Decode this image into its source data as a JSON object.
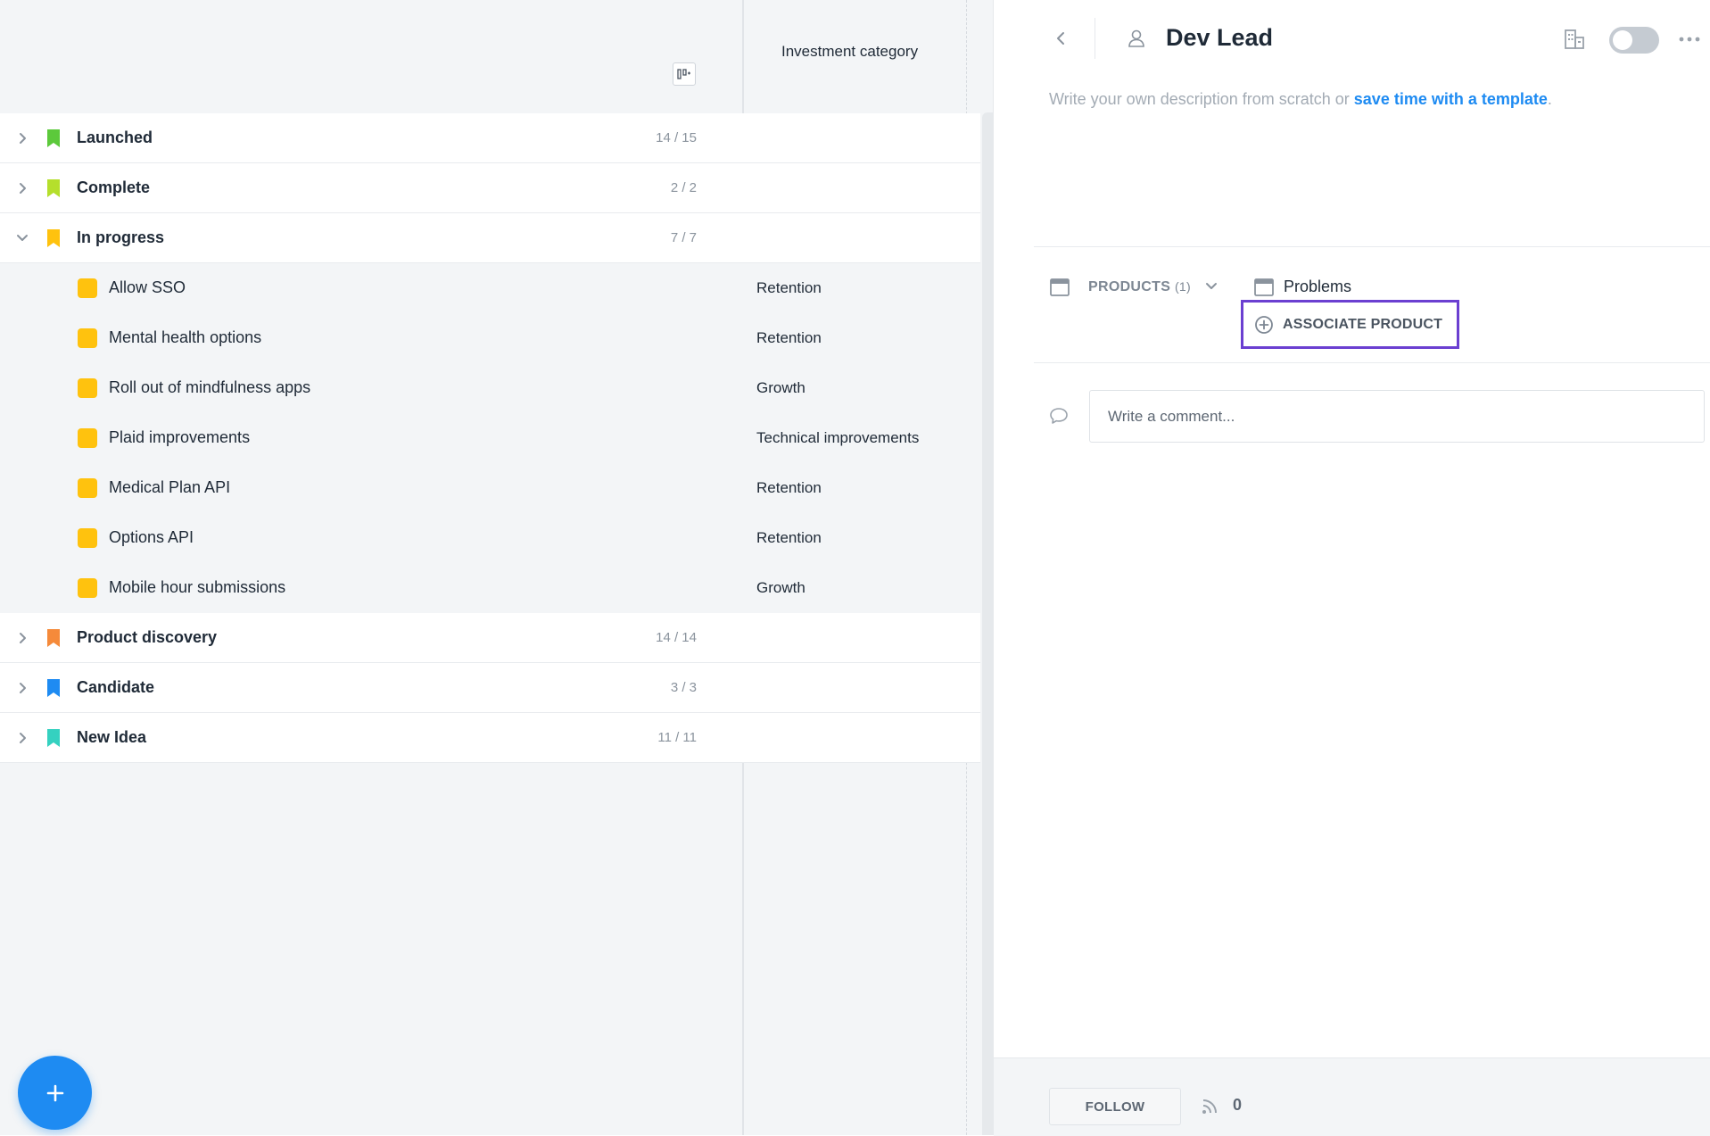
{
  "table": {
    "column_header": "Investment category",
    "rows": [
      {
        "type": "group",
        "label": "Launched",
        "count": "14 / 15",
        "color": "#5cc93b",
        "expanded": false,
        "category": ""
      },
      {
        "type": "group",
        "label": "Complete",
        "count": "2 / 2",
        "color": "#b5df2c",
        "expanded": false,
        "category": ""
      },
      {
        "type": "group",
        "label": "In progress",
        "count": "7 / 7",
        "color": "#ffc20e",
        "expanded": true,
        "category": ""
      },
      {
        "type": "child",
        "label": "Allow SSO",
        "category": "Retention",
        "color": "#ffc20e"
      },
      {
        "type": "child",
        "label": "Mental health options",
        "category": "Retention",
        "color": "#ffc20e"
      },
      {
        "type": "child",
        "label": "Roll out of mindfulness apps",
        "category": "Growth",
        "color": "#ffc20e"
      },
      {
        "type": "child",
        "label": "Plaid improvements",
        "category": "Technical improvements",
        "color": "#ffc20e"
      },
      {
        "type": "child",
        "label": "Medical Plan API",
        "category": "Retention",
        "color": "#ffc20e"
      },
      {
        "type": "child",
        "label": "Options API",
        "category": "Retention",
        "color": "#ffc20e"
      },
      {
        "type": "child",
        "label": "Mobile hour submissions",
        "category": "Growth",
        "color": "#ffc20e"
      },
      {
        "type": "group",
        "label": "Product discovery",
        "count": "14 / 14",
        "color": "#f58a3a",
        "expanded": false,
        "category": ""
      },
      {
        "type": "group",
        "label": "Candidate",
        "count": "3 / 3",
        "color": "#1e8bf2",
        "expanded": false,
        "category": ""
      },
      {
        "type": "group",
        "label": "New Idea",
        "count": "11 / 11",
        "color": "#35d1c0",
        "expanded": false,
        "category": ""
      }
    ]
  },
  "fab": {
    "label": "+",
    "color": "#1e8bf2"
  },
  "detail": {
    "title": "Dev Lead",
    "toggle_on": false,
    "description_prefix": "Write your own description from scratch or ",
    "description_link": "save time with a template",
    "description_suffix": ".",
    "products_label": "PRODUCTS",
    "products_count": "(1)",
    "problems_label": "Problems",
    "associate_label": "ASSOCIATE PRODUCT",
    "highlight_color": "#6b3fd1",
    "comment_placeholder": "Write a comment...",
    "follow_label": "FOLLOW",
    "follow_count": "0"
  },
  "icons": {
    "back": "chevron-left-icon",
    "person": "person-icon",
    "building": "building-icon",
    "more": "more-horizontal-icon",
    "products": "window-icon",
    "comment": "speech-bubble-icon",
    "signal": "signal-icon",
    "plus_circle": "plus-circle-icon",
    "column_settings": "column-settings-icon"
  }
}
